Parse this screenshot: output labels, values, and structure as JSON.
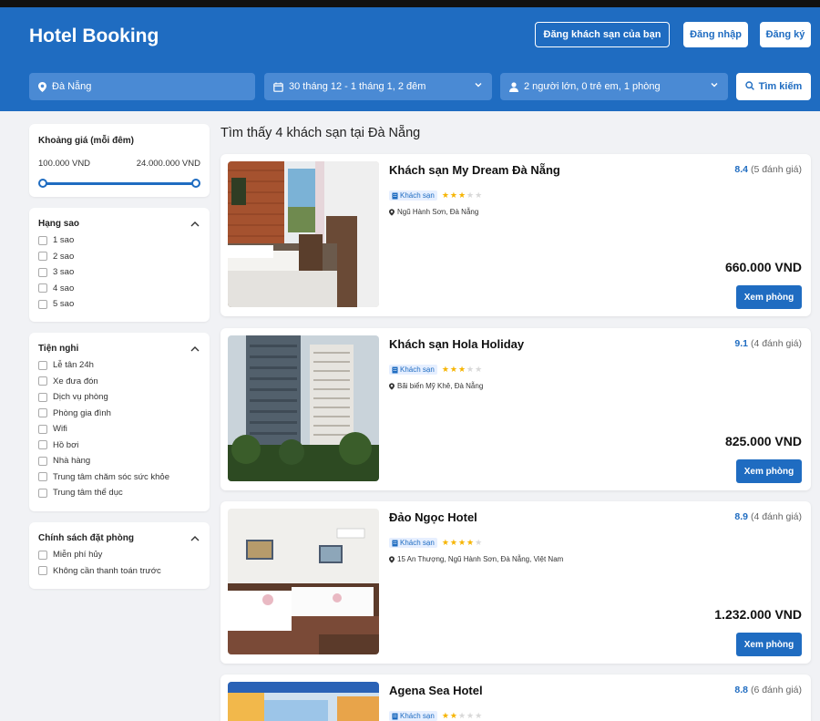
{
  "header": {
    "brand": "Hotel Booking",
    "register_hotel": "Đăng khách sạn của bạn",
    "login": "Đăng nhập",
    "signup": "Đăng ký",
    "colors": {
      "primary": "#1f6cc1",
      "field": "#4a8ad4"
    }
  },
  "search": {
    "location": "Đà Nẵng",
    "dates": "30 tháng 12 - 1 tháng 1, 2 đêm",
    "guests": "2 người lớn, 0 trẻ em, 1 phòng",
    "button": "Tìm kiếm",
    "icons": {
      "location": "map-pin-icon",
      "dates": "calendar-icon",
      "guests": "user-icon",
      "button": "search-icon"
    }
  },
  "filters": {
    "price": {
      "title": "Khoảng giá (mỗi đêm)",
      "min": "100.000 VND",
      "max": "24.000.000 VND"
    },
    "stars": {
      "title": "Hạng sao",
      "options": [
        "1 sao",
        "2 sao",
        "3 sao",
        "4 sao",
        "5 sao"
      ]
    },
    "amenities": {
      "title": "Tiện nghi",
      "options": [
        "Lễ tân 24h",
        "Xe đưa đón",
        "Dịch vụ phòng",
        "Phòng gia đình",
        "Wifi",
        "Hồ bơi",
        "Nhà hàng",
        "Trung tâm chăm sóc sức khỏe",
        "Trung tâm thể dục"
      ]
    },
    "policy": {
      "title": "Chính sách đặt phòng",
      "options": [
        "Miễn phí hủy",
        "Không cần thanh toán trước"
      ]
    }
  },
  "results": {
    "title": "Tìm thấy 4 khách sạn tại Đà Nẵng",
    "hotels": [
      {
        "name": "Khách sạn My Dream Đà Nẵng",
        "score": "8.4",
        "reviews": "(5 đánh giá)",
        "type": "Khách sạn",
        "stars": 3,
        "address": "Ngũ Hành Sơn, Đà Nẵng",
        "price": "660.000 VND",
        "button": "Xem phòng"
      },
      {
        "name": "Khách sạn Hola Holiday",
        "score": "9.1",
        "reviews": "(4 đánh giá)",
        "type": "Khách sạn",
        "stars": 3,
        "address": "Bãi biển Mỹ Khê, Đà Nẵng",
        "price": "825.000 VND",
        "button": "Xem phòng"
      },
      {
        "name": "Đảo Ngọc Hotel",
        "score": "8.9",
        "reviews": "(4 đánh giá)",
        "type": "Khách sạn",
        "stars": 4,
        "address": "15 An Thượng, Ngũ Hành Sơn, Đà Nẵng, Việt Nam",
        "price": "1.232.000 VND",
        "button": "Xem phòng"
      },
      {
        "name": "Agena Sea Hotel",
        "score": "8.8",
        "reviews": "(6 đánh giá)",
        "type": "Khách sạn",
        "stars": 2,
        "address": "",
        "price": "",
        "button": ""
      }
    ]
  }
}
